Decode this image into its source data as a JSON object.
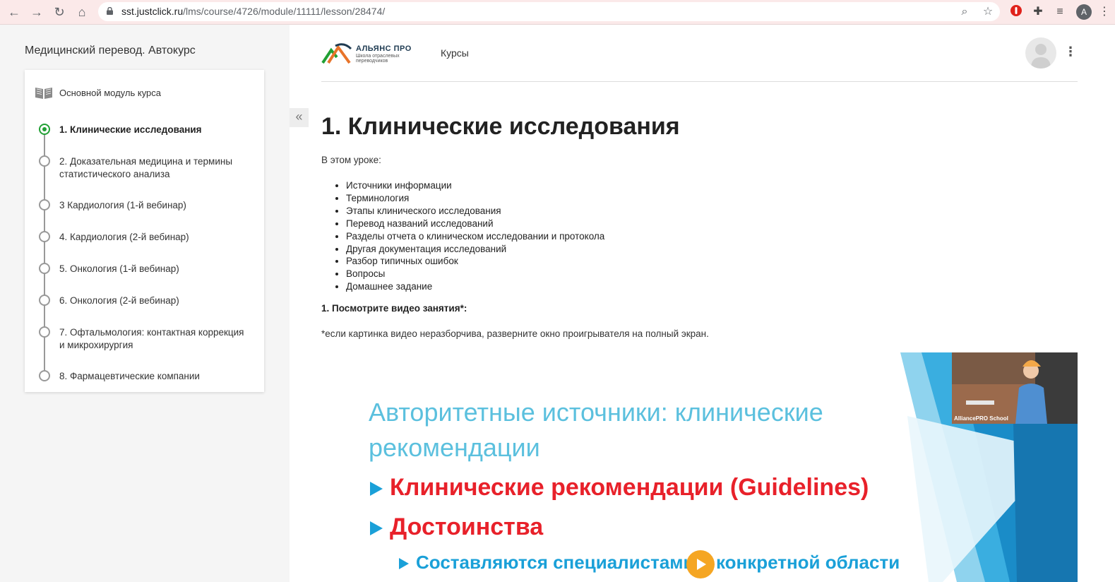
{
  "browser": {
    "url_host": "sst.justclick.ru",
    "url_path": "/lms/course/4726/module/11111/lesson/28474/",
    "profile_initial": "A"
  },
  "sidebar": {
    "course_title": "Медицинский перевод. Автокурс",
    "module_label": "Основной модуль курса",
    "lessons": [
      {
        "label": "1. Клинические исследования",
        "active": true
      },
      {
        "label": "2. Доказательная медицина и термины статистического анализа",
        "active": false
      },
      {
        "label": "3 Кардиология (1-й вебинар)",
        "active": false
      },
      {
        "label": "4. Кардиология (2-й вебинар)",
        "active": false
      },
      {
        "label": "5. Онкология (1-й вебинар)",
        "active": false
      },
      {
        "label": "6. Онкология (2-й вебинар)",
        "active": false
      },
      {
        "label": "7. Офтальмология: контактная коррекция и микрохирургия",
        "active": false
      },
      {
        "label": "8. Фармацевтические компании",
        "active": false
      }
    ]
  },
  "header": {
    "logo_title": "АЛЬЯНС ПРО",
    "logo_subtitle": "Школа отраслевых переводчиков",
    "nav_courses": "Курсы"
  },
  "lesson": {
    "title": "1. Клинические исследования",
    "intro": "В этом уроке:",
    "topics": [
      "Источники информации",
      "Терминология",
      "Этапы клинического исследования",
      "Перевод названий исследований",
      "Разделы отчета о клиническом исследовании и протокола",
      "Другая документация исследований",
      "Разбор типичных ошибок",
      "Вопросы",
      "Домашнее задание"
    ],
    "task": "1. Посмотрите видео занятия*:",
    "note": "*если картинка видео неразборчива, разверните окно проигрывателя на полный экран."
  },
  "video": {
    "slide_title": "Авторитетные источники: клинические рекомендации",
    "bullet_1": "Клинические рекомендации (Guidelines)",
    "bullet_2": "Достоинства",
    "bullet_3": "Составляются специалистами в конкретной области",
    "webcam_label": "AlliancePRO School"
  },
  "colors": {
    "active_green": "#21a034",
    "slide_blue": "#5bc0de",
    "slide_red": "#e8212a",
    "play_orange": "#f5a623"
  }
}
